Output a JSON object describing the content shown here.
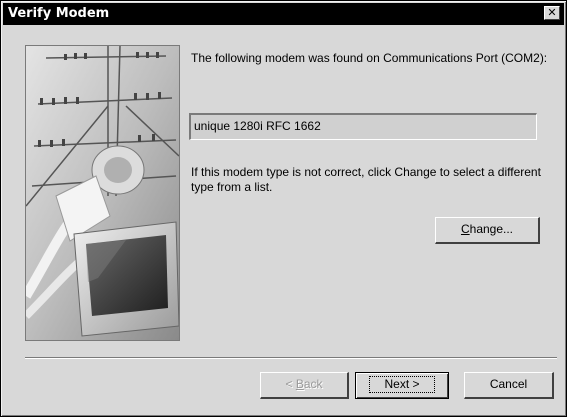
{
  "window": {
    "title": "Verify Modem",
    "close_glyph": "✕"
  },
  "content": {
    "found_message": "The following modem was found on Communications Port (COM2):",
    "modem_name": "unique 1280i RFC 1662",
    "change_message": "If this modem type is not correct, click Change to select a different type from a list.",
    "change_button_mnemonic": "C",
    "change_button_rest": "hange..."
  },
  "buttons": {
    "back_prefix": "< ",
    "back_mnemonic": "B",
    "back_rest": "ack",
    "next_label": "Next >",
    "cancel_label": "Cancel"
  },
  "image": {
    "name": "modem-illustration"
  }
}
